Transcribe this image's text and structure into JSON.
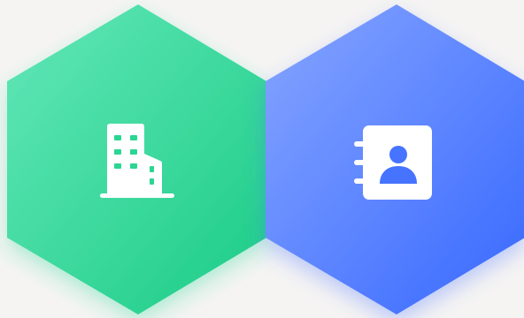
{
  "tiles": [
    {
      "id": "company",
      "icon": "building-icon",
      "gradient": [
        "#5fe5b4",
        "#1ecf8a"
      ],
      "shadow": "#2fd99a",
      "icon_color": "#ffffff"
    },
    {
      "id": "contacts",
      "icon": "contact-book-icon",
      "gradient": [
        "#7a9cff",
        "#3a6cff"
      ],
      "shadow": "#4a76ff",
      "icon_color": "#ffffff"
    }
  ]
}
